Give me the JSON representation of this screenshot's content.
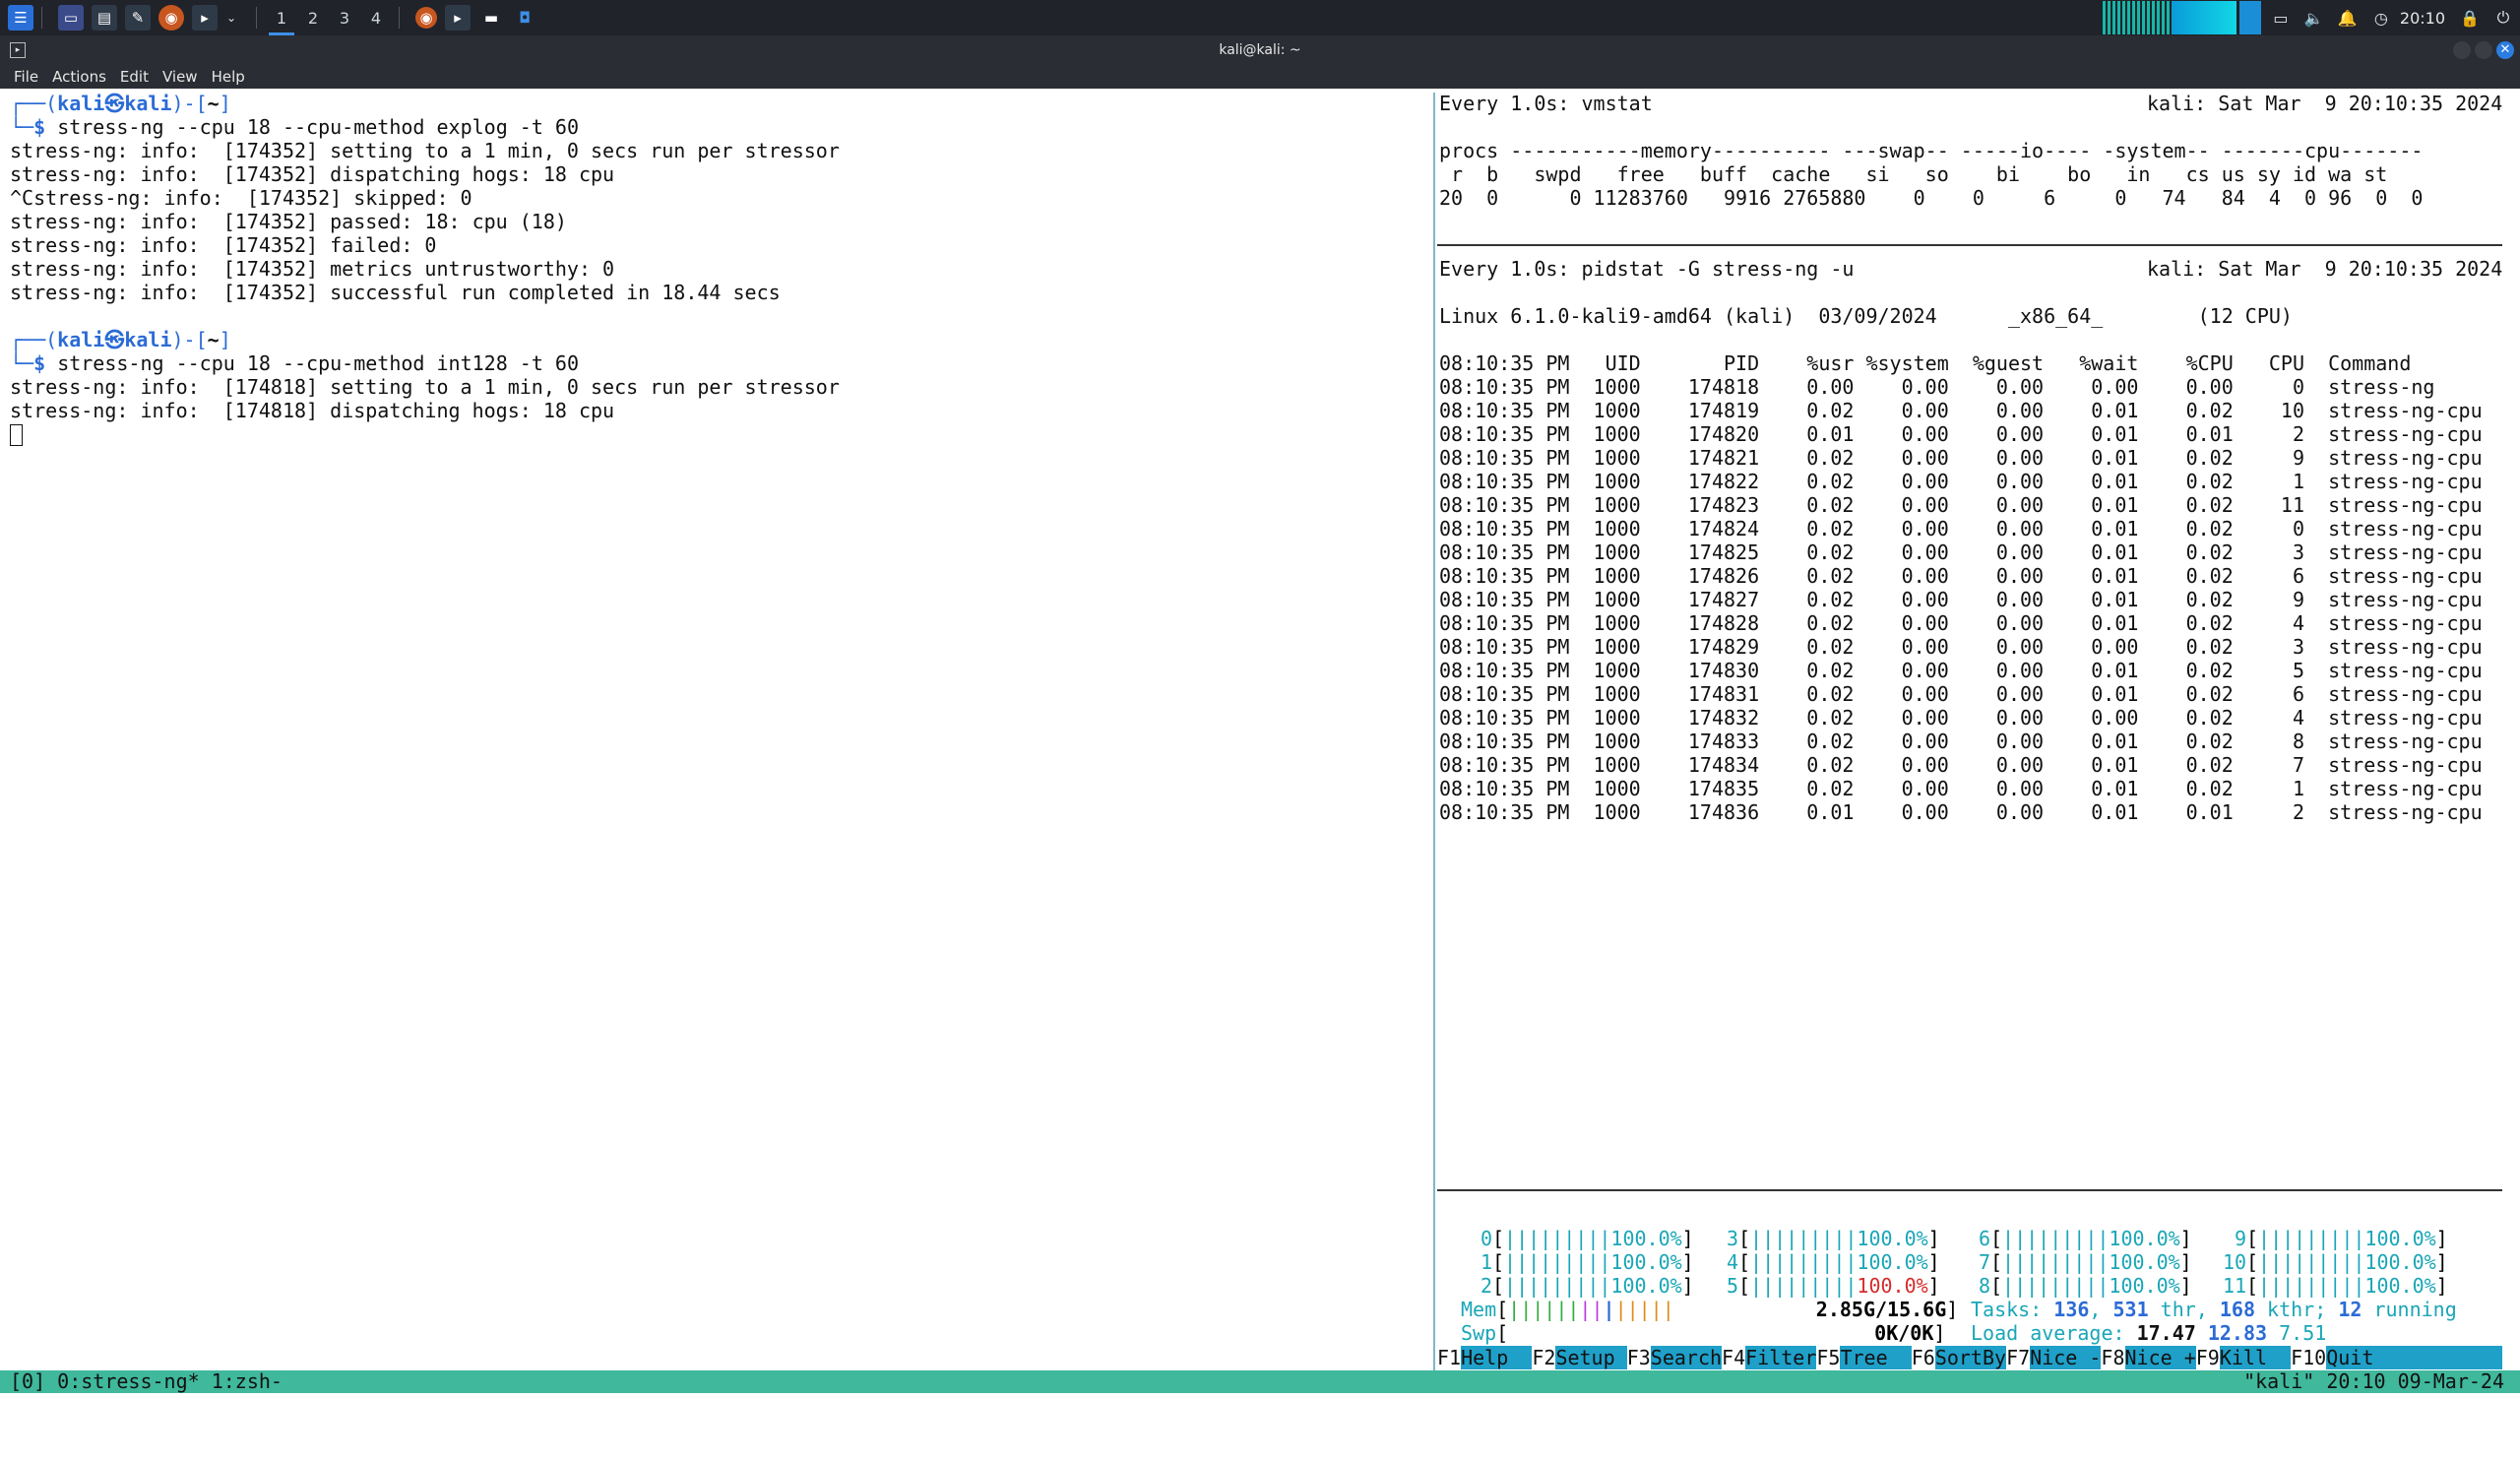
{
  "panel": {
    "workspaces": [
      "1",
      "2",
      "3",
      "4"
    ],
    "clock": "20:10"
  },
  "window": {
    "title": "kali@kali: ~"
  },
  "menu": [
    "File",
    "Actions",
    "Edit",
    "View",
    "Help"
  ],
  "left": {
    "prompt_user": "kali",
    "prompt_host": "kali",
    "prompt_dir": "~",
    "cmd1": "stress-ng --cpu 18 --cpu-method explog -t 60",
    "out1": [
      "stress-ng: info:  [174352] setting to a 1 min, 0 secs run per stressor",
      "stress-ng: info:  [174352] dispatching hogs: 18 cpu",
      "^Cstress-ng: info:  [174352] skipped: 0",
      "stress-ng: info:  [174352] passed: 18: cpu (18)",
      "stress-ng: info:  [174352] failed: 0",
      "stress-ng: info:  [174352] metrics untrustworthy: 0",
      "stress-ng: info:  [174352] successful run completed in 18.44 secs"
    ],
    "cmd2": "stress-ng --cpu 18 --cpu-method int128 -t 60",
    "out2": [
      "stress-ng: info:  [174818] setting to a 1 min, 0 secs run per stressor",
      "stress-ng: info:  [174818] dispatching hogs: 18 cpu"
    ]
  },
  "vmstat": {
    "header": "Every 1.0s: vmstat",
    "host_time": "kali: Sat Mar  9 20:10:35 2024",
    "groups": "procs -----------memory---------- ---swap-- -----io---- -system-- -------cpu-------",
    "cols": " r  b   swpd   free   buff  cache   si   so    bi    bo   in   cs us sy id wa st",
    "values": "20  0      0 11283760   9916 2765880    0    0     6     0   74   84  4  0 96  0  0"
  },
  "pidstat": {
    "header": "Every 1.0s: pidstat -G stress-ng -u",
    "host_time": "kali: Sat Mar  9 20:10:35 2024",
    "sysinfo": "Linux 6.1.0-kali9-amd64 (kali)  03/09/2024      _x86_64_        (12 CPU)",
    "columns": "08:10:35 PM   UID       PID    %usr %system  %guest   %wait    %CPU   CPU  Command",
    "rows": [
      "08:10:35 PM  1000    174818    0.00    0.00    0.00    0.00    0.00     0  stress-ng",
      "08:10:35 PM  1000    174819    0.02    0.00    0.00    0.01    0.02    10  stress-ng-cpu",
      "08:10:35 PM  1000    174820    0.01    0.00    0.00    0.01    0.01     2  stress-ng-cpu",
      "08:10:35 PM  1000    174821    0.02    0.00    0.00    0.01    0.02     9  stress-ng-cpu",
      "08:10:35 PM  1000    174822    0.02    0.00    0.00    0.01    0.02     1  stress-ng-cpu",
      "08:10:35 PM  1000    174823    0.02    0.00    0.00    0.01    0.02    11  stress-ng-cpu",
      "08:10:35 PM  1000    174824    0.02    0.00    0.00    0.01    0.02     0  stress-ng-cpu",
      "08:10:35 PM  1000    174825    0.02    0.00    0.00    0.01    0.02     3  stress-ng-cpu",
      "08:10:35 PM  1000    174826    0.02    0.00    0.00    0.01    0.02     6  stress-ng-cpu",
      "08:10:35 PM  1000    174827    0.02    0.00    0.00    0.01    0.02     9  stress-ng-cpu",
      "08:10:35 PM  1000    174828    0.02    0.00    0.00    0.01    0.02     4  stress-ng-cpu",
      "08:10:35 PM  1000    174829    0.02    0.00    0.00    0.00    0.02     3  stress-ng-cpu",
      "08:10:35 PM  1000    174830    0.02    0.00    0.00    0.01    0.02     5  stress-ng-cpu",
      "08:10:35 PM  1000    174831    0.02    0.00    0.00    0.01    0.02     6  stress-ng-cpu",
      "08:10:35 PM  1000    174832    0.02    0.00    0.00    0.00    0.02     4  stress-ng-cpu",
      "08:10:35 PM  1000    174833    0.02    0.00    0.00    0.01    0.02     8  stress-ng-cpu",
      "08:10:35 PM  1000    174834    0.02    0.00    0.00    0.01    0.02     7  stress-ng-cpu",
      "08:10:35 PM  1000    174835    0.02    0.00    0.00    0.01    0.02     1  stress-ng-cpu",
      "08:10:35 PM  1000    174836    0.01    0.00    0.00    0.01    0.01     2  stress-ng-cpu"
    ]
  },
  "htop": {
    "cpus": [
      {
        "id": "0",
        "pct": "100.0%"
      },
      {
        "id": "1",
        "pct": "100.0%"
      },
      {
        "id": "2",
        "pct": "100.0%"
      },
      {
        "id": "3",
        "pct": "100.0%"
      },
      {
        "id": "4",
        "pct": "100.0%"
      },
      {
        "id": "5",
        "pct": "100.0%"
      },
      {
        "id": "6",
        "pct": "100.0%"
      },
      {
        "id": "7",
        "pct": "100.0%"
      },
      {
        "id": "8",
        "pct": "100.0%"
      },
      {
        "id": "9",
        "pct": "100.0%"
      },
      {
        "id": "10",
        "pct": "100.0%"
      },
      {
        "id": "11",
        "pct": "100.0%"
      }
    ],
    "mem_label": "Mem",
    "mem_value": "2.85G/15.6G",
    "swp_label": "Swp",
    "swp_value": "0K/0K",
    "tasks_label": "Tasks: ",
    "tasks": "136",
    "thr": "531",
    "thr_label": " thr, ",
    "kthr": "168",
    "kthr_label": " kthr",
    "running": "12",
    "running_label": " running",
    "load_label": "Load average: ",
    "load1": "17.47",
    "load5": "12.83",
    "load15": "7.51",
    "fkeys": [
      {
        "k": "F1",
        "l": "Help  "
      },
      {
        "k": "F2",
        "l": "Setup "
      },
      {
        "k": "F3",
        "l": "Search"
      },
      {
        "k": "F4",
        "l": "Filter"
      },
      {
        "k": "F5",
        "l": "Tree  "
      },
      {
        "k": "F6",
        "l": "SortBy"
      },
      {
        "k": "F7",
        "l": "Nice -"
      },
      {
        "k": "F8",
        "l": "Nice +"
      },
      {
        "k": "F9",
        "l": "Kill  "
      },
      {
        "k": "F10",
        "l": "Quit  "
      }
    ]
  },
  "tmux": {
    "left": "[0] 0:stress-ng* 1:zsh-",
    "right": "\"kali\" 20:10 09-Mar-24"
  }
}
